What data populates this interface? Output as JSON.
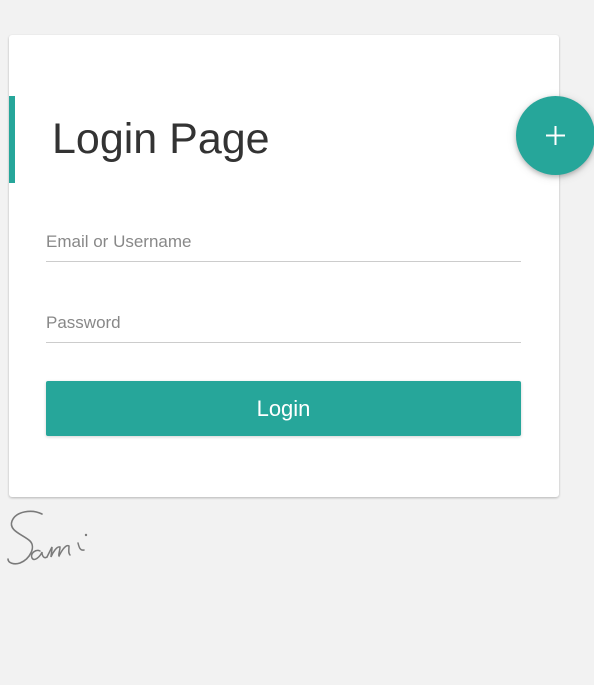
{
  "page": {
    "title": "Login Page"
  },
  "form": {
    "email_placeholder": "Email or Username",
    "email_value": "",
    "password_placeholder": "Password",
    "password_value": "",
    "login_label": "Login"
  },
  "fab": {
    "icon": "plus-icon"
  },
  "signature": {
    "text": "Sami"
  },
  "colors": {
    "accent": "#26a69a",
    "background": "#f2f2f2",
    "card": "#ffffff",
    "title_text": "#333333"
  }
}
